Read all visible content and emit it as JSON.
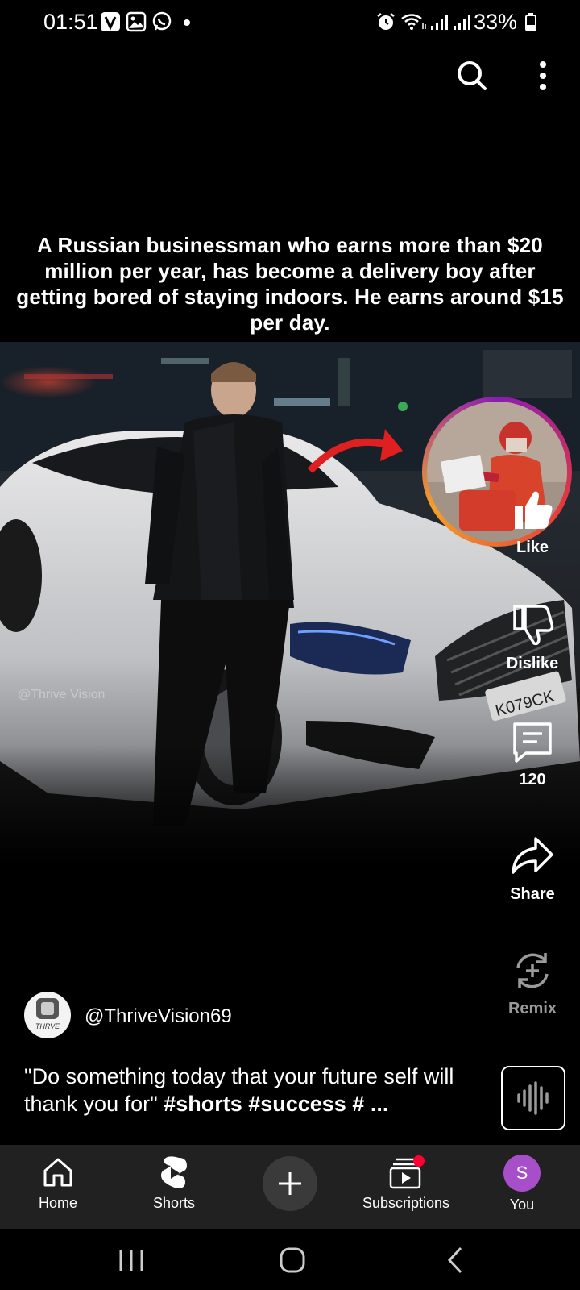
{
  "status_bar": {
    "time": "01:51",
    "battery": "33%"
  },
  "caption": {
    "text": "A Russian businessman who earns more than $20 million per year, has become a delivery boy after getting bored of staying indoors. He earns around $15 per day."
  },
  "video": {
    "watermark": "@Thrive Vision",
    "plate_text": "K079CK"
  },
  "actions": {
    "like_label": "Like",
    "dislike_label": "Dislike",
    "comments_count": "120",
    "share_label": "Share",
    "remix_label": "Remix"
  },
  "channel": {
    "handle": "@ThriveVision69",
    "avatar_text": "THRVE"
  },
  "description": {
    "quote": "\"Do something today that your future self will thank you for\" ",
    "tags": "#shorts #success # ..."
  },
  "nav": {
    "home": "Home",
    "shorts": "Shorts",
    "subscriptions": "Subscriptions",
    "you": "You",
    "you_initial": "S"
  },
  "colors": {
    "nav_bg": "#212121",
    "you_avatar": "#a64fc8",
    "notification_dot": "#ff0033",
    "ring_gradient": [
      "#8a1bb5",
      "#e63a3a",
      "#f3a02a"
    ]
  }
}
